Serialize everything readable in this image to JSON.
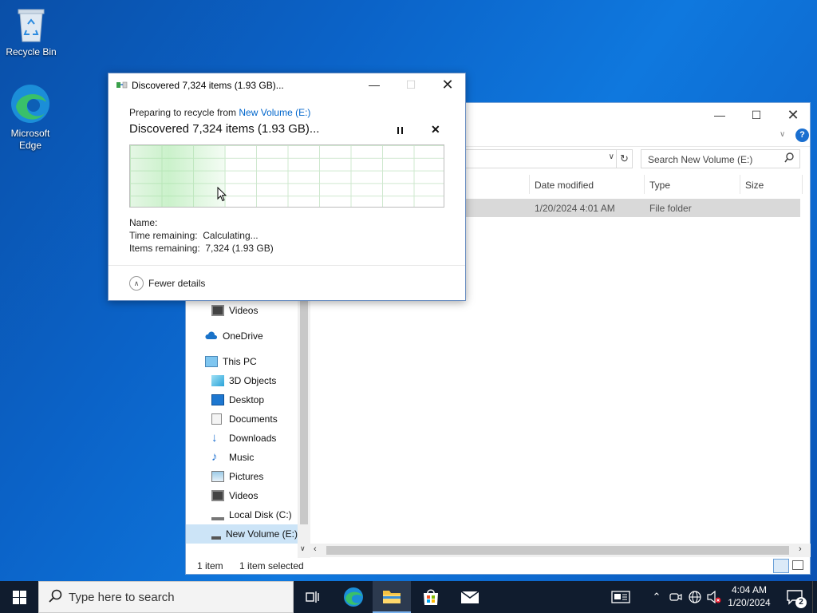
{
  "desktop": {
    "icons": [
      {
        "label": "Recycle Bin"
      },
      {
        "label": "Microsoft Edge"
      }
    ]
  },
  "explorer": {
    "search_placeholder": "Search New Volume (E:)",
    "columns": [
      "Date modified",
      "Type",
      "Size"
    ],
    "row": {
      "date_modified": "1/20/2024 4:01 AM",
      "type": "File folder"
    },
    "nav": [
      {
        "label": "Videos",
        "icon": "videos-icon"
      },
      {
        "label": "OneDrive",
        "icon": "onedrive-icon"
      },
      {
        "label": "This PC",
        "icon": "this-pc-icon"
      },
      {
        "label": "3D Objects",
        "icon": "3d-objects-icon"
      },
      {
        "label": "Desktop",
        "icon": "desktop-icon"
      },
      {
        "label": "Documents",
        "icon": "documents-icon"
      },
      {
        "label": "Downloads",
        "icon": "downloads-icon"
      },
      {
        "label": "Music",
        "icon": "music-icon"
      },
      {
        "label": "Pictures",
        "icon": "pictures-icon"
      },
      {
        "label": "Videos",
        "icon": "videos-icon"
      },
      {
        "label": "Local Disk (C:)",
        "icon": "drive-icon"
      },
      {
        "label": "New Volume (E:)",
        "icon": "drive-icon"
      }
    ],
    "status": {
      "count": "1 item",
      "selected": "1 item selected"
    }
  },
  "dialog": {
    "title": "Discovered 7,324 items (1.93 GB)...",
    "preparing_prefix": "Preparing to recycle from ",
    "preparing_link": "New Volume (E:)",
    "heading": "Discovered 7,324 items (1.93 GB)...",
    "name_label": "Name:",
    "time_label": "Time remaining:",
    "time_value": "Calculating...",
    "items_label": "Items remaining:",
    "items_value": "7,324 (1.93 GB)",
    "fewer_details": "Fewer details"
  },
  "taskbar": {
    "search_placeholder": "Type here to search",
    "time": "4:04 AM",
    "date": "1/20/2024",
    "notification_count": "2"
  },
  "colors": {
    "accent": "#0067c0",
    "link": "#0066cc",
    "taskbar": "#101c2e"
  }
}
